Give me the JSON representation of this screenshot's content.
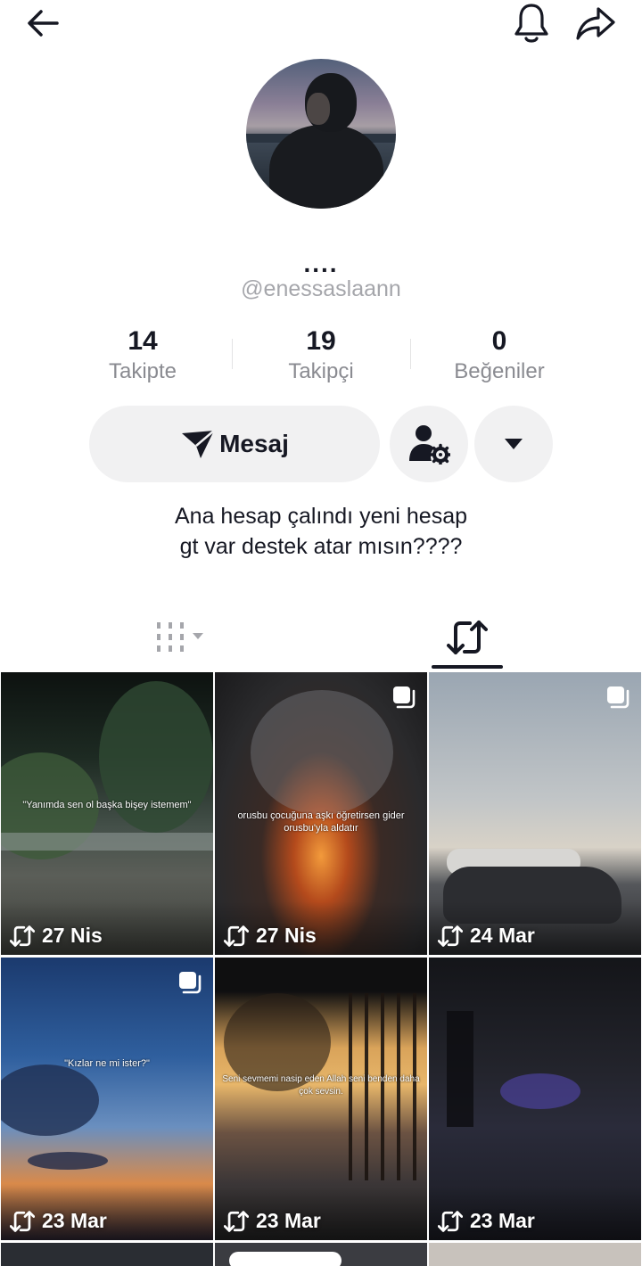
{
  "header": {
    "back_icon": "arrow-left-icon",
    "bell_icon": "bell-icon",
    "share_icon": "share-arrow-icon"
  },
  "profile": {
    "display_name": "....",
    "username": "@enessaslaann",
    "bio_line1": "Ana hesap çalındı yeni hesap",
    "bio_line2": "gt var destek atar mısın????"
  },
  "stats": [
    {
      "value": "14",
      "label": "Takipte"
    },
    {
      "value": "19",
      "label": "Takipçi"
    },
    {
      "value": "0",
      "label": "Beğeniler"
    }
  ],
  "actions": {
    "message_label": "Mesaj",
    "message_icon": "send-icon",
    "friends_icon": "user-settings-icon",
    "more_icon": "caret-down-icon"
  },
  "tabs": {
    "videos_icon": "grid-columns-icon",
    "reposts_icon": "repost-icon",
    "active": "reposts"
  },
  "posts": [
    {
      "date": "27 Nis",
      "caption": "\"Yanımda sen ol başka bişey istemem\"",
      "multi": false
    },
    {
      "date": "27 Nis",
      "caption": "orusbu çocuğuna aşkı öğretirsen gider orusbu'yla aldatır",
      "multi": true
    },
    {
      "date": "24 Mar",
      "caption": "",
      "multi": true
    },
    {
      "date": "23 Mar",
      "caption": "\"Kızlar ne mi ister?\"",
      "multi": true
    },
    {
      "date": "23 Mar",
      "caption": "Seni sevmemi nasip eden Allah seni benden daha çok sevsin.",
      "multi": false
    },
    {
      "date": "23 Mar",
      "caption": "",
      "multi": false
    }
  ],
  "colors": {
    "text": "#161823",
    "muted": "#8a8b91",
    "button_bg": "#f1f1f2"
  }
}
